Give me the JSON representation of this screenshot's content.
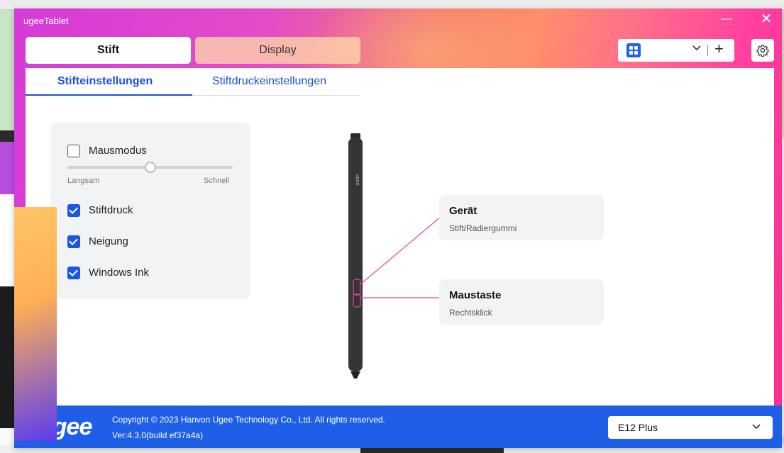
{
  "app": {
    "title": "ugeeTablet"
  },
  "window_controls": {
    "minimize": "—",
    "close": "✕"
  },
  "main_tabs": [
    {
      "label": "Stift",
      "active": true
    },
    {
      "label": "Display",
      "active": false
    }
  ],
  "toolbar": {
    "device_icon": "grid-icon",
    "dropdown_icon": "chevron-down-icon",
    "add_label": "+",
    "settings_icon": "gear-icon"
  },
  "sub_tabs": [
    {
      "label": "Stifteinstellungen",
      "active": true
    },
    {
      "label": "Stiftdruckeinstellungen",
      "active": false
    }
  ],
  "settings": {
    "mouse_mode": {
      "label": "Mausmodus",
      "checked": false
    },
    "speed_slider": {
      "min_label": "Langsam",
      "max_label": "Schnell",
      "value": 0.5
    },
    "pen_pressure": {
      "label": "Stiftdruck",
      "checked": true
    },
    "tilt": {
      "label": "Neigung",
      "checked": true
    },
    "windows_ink": {
      "label": "Windows Ink",
      "checked": true
    }
  },
  "pen": {
    "brand_text": "ugee"
  },
  "callouts": [
    {
      "title": "Gerät",
      "subtitle": "Stift/Radiergummi"
    },
    {
      "title": "Maustaste",
      "subtitle": "Rechtsklick"
    }
  ],
  "footer": {
    "logo": "ugee",
    "copyright": "Copyright © 2023 Hanvon Ugee Technology Co., Ltd. All rights reserved.",
    "version": "Ver:4.3.0(build ef37a4a)",
    "model": "E12 Plus"
  },
  "colors": {
    "accent": "#1a55e3",
    "footer": "#1f5fe8",
    "callout_line": "#e8459b"
  }
}
